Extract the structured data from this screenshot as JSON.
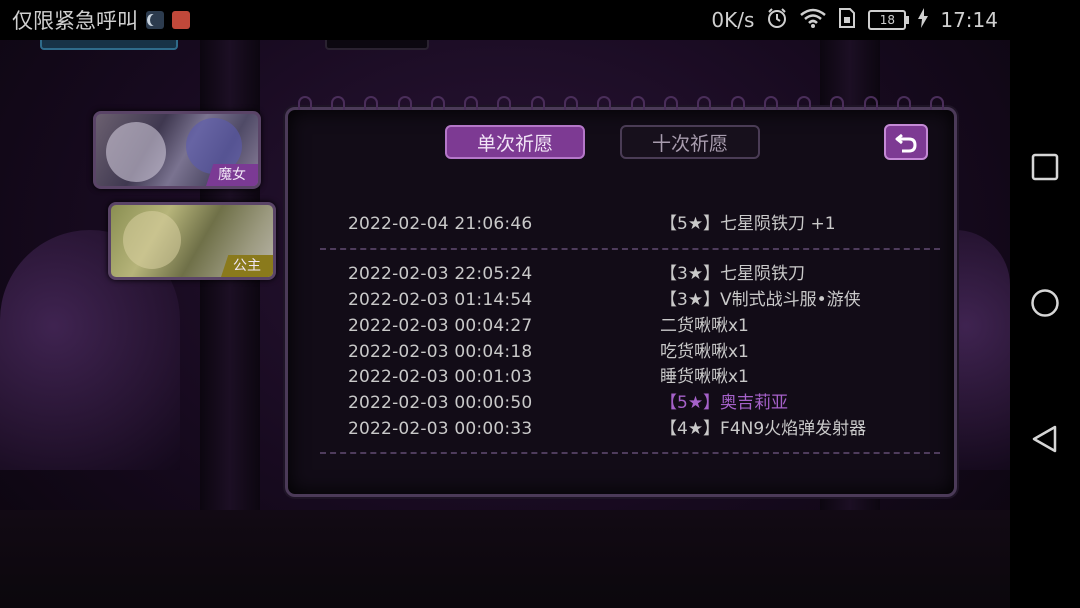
{
  "status_bar": {
    "carrier_text": "仅限紧急呼叫",
    "net_speed": "0K/s",
    "battery": "18",
    "time": "17:14",
    "icons": [
      "moon-icon",
      "app-notification-icon",
      "alarm-icon",
      "wifi-icon",
      "sim-icon",
      "battery-icon",
      "charging-icon"
    ]
  },
  "cards": [
    {
      "tag": "魔女"
    },
    {
      "tag": "公主"
    }
  ],
  "tabs": {
    "single": "单次祈愿",
    "ten": "十次祈愿",
    "active": "single"
  },
  "records": [
    {
      "time": "2022-02-04 21:06:46",
      "item": "【5★】七星陨铁刀 +1"
    },
    {
      "time": "2022-02-03 22:05:24",
      "item": "【3★】七星陨铁刀"
    },
    {
      "time": "2022-02-03 01:14:54",
      "item": "【3★】V制式战斗服•游侠"
    },
    {
      "time": "2022-02-03 00:04:27",
      "item": "二货啾啾x1"
    },
    {
      "time": "2022-02-03 00:04:18",
      "item": "吃货啾啾x1"
    },
    {
      "time": "2022-02-03 00:01:03",
      "item": "睡货啾啾x1"
    },
    {
      "time": "2022-02-03 00:00:50",
      "item": "【5★】奥吉莉亚",
      "highlight": true
    },
    {
      "time": "2022-02-03 00:00:33",
      "item": "【4★】F4N9火焰弹发射器"
    }
  ],
  "colors": {
    "accent_purple": "#7d3a93",
    "highlight_text": "#a561c9",
    "panel_bg": "#120c17"
  },
  "nav_bar": [
    "recents-square-icon",
    "home-circle-icon",
    "back-triangle-icon"
  ]
}
